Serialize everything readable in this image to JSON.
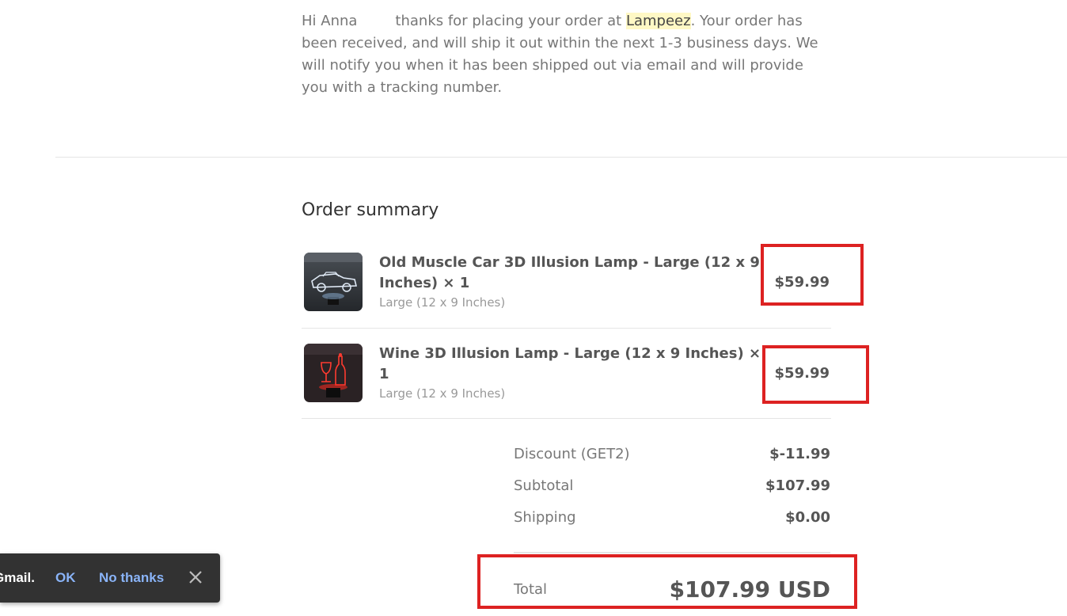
{
  "intro": {
    "greeting": "Hi Anna",
    "text_before": "thanks for placing your order at ",
    "store_name": "Lampeez",
    "text_after": ". Your order has been received, and will ship it out within the next 1-3 business days. We will notify you when it has been shipped out via email and will provide you with a tracking number."
  },
  "order_summary": {
    "title": "Order summary",
    "items": [
      {
        "name": "Old Muscle Car 3D Illusion Lamp - Large (12 x 9 Inches) × 1",
        "variant": "Large (12 x 9 Inches)",
        "price": "$59.99",
        "thumbnail_icon": "car-lamp-image"
      },
      {
        "name": "Wine 3D Illusion Lamp - Large (12 x 9 Inches) × 1",
        "variant": "Large (12 x 9 Inches)",
        "price": "$59.99",
        "thumbnail_icon": "wine-lamp-image"
      }
    ],
    "totals": {
      "discount_label": "Discount (GET2)",
      "discount_value": "$-11.99",
      "subtotal_label": "Subtotal",
      "subtotal_value": "$107.99",
      "shipping_label": "Shipping",
      "shipping_value": "$0.00",
      "total_label": "Total",
      "total_value": "$107.99 USD"
    }
  },
  "snackbar": {
    "message": "Gmail.",
    "ok_label": "OK",
    "no_thanks_label": "No thanks",
    "close_icon": "close-icon"
  },
  "colors": {
    "highlight": "#fff8c5",
    "annotation_box": "#dd2222",
    "snackbar_bg": "#323232",
    "snackbar_action": "#8ab4f8"
  }
}
